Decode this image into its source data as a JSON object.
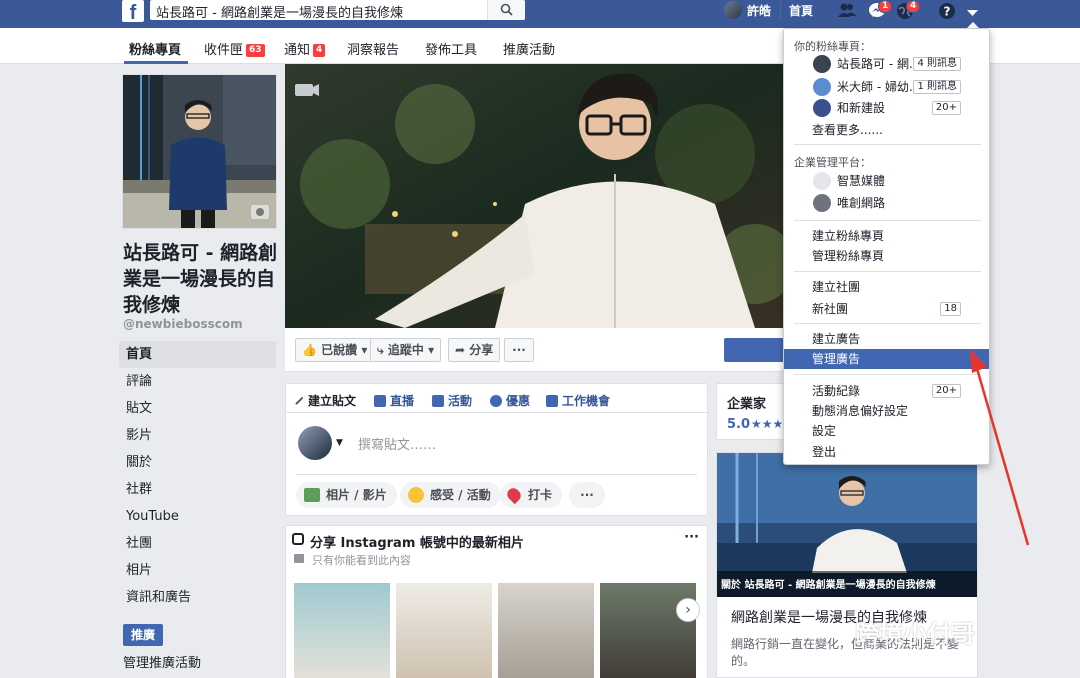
{
  "topbar": {
    "search_text": "站長路可 - 網路創業是一場漫長的自我修煉",
    "user_name": "許皓",
    "home_label": "首頁",
    "messages_count": "1",
    "notifications_count": "4"
  },
  "tabs": [
    {
      "label": "粉絲專頁",
      "badge": ""
    },
    {
      "label": "收件匣",
      "badge": "63"
    },
    {
      "label": "通知",
      "badge": "4"
    },
    {
      "label": "洞察報告",
      "badge": ""
    },
    {
      "label": "發佈工具",
      "badge": ""
    },
    {
      "label": "推廣活動",
      "badge": ""
    }
  ],
  "page": {
    "name": "站長路可 - 網路創業是一場漫長的自我修煉",
    "handle": "@newbiebosscom"
  },
  "left_nav": [
    "首頁",
    "評論",
    "貼文",
    "影片",
    "關於",
    "社群",
    "YouTube",
    "社團",
    "相片",
    "資訊和廣告"
  ],
  "promote_label": "推廣",
  "manage_promotions_label": "管理推廣活動",
  "actions": {
    "liked": "已說讚",
    "following": "追蹤中",
    "share": "分享",
    "more": "···"
  },
  "composer": {
    "tabs": [
      "建立貼文",
      "直播",
      "活動",
      "優惠",
      "工作機會"
    ],
    "placeholder": "撰寫貼文……",
    "pills": [
      "相片 / 影片",
      "感受 / 活動",
      "打卡"
    ],
    "more": "···"
  },
  "instagram": {
    "title": "分享 Instagram 帳號中的最新相片",
    "subtitle": "只有你能看到此內容",
    "more": "···"
  },
  "rating": {
    "category": "企業家",
    "score": "5.0",
    "stars": "★★★"
  },
  "about_card": {
    "caption": "關於 站長路可 - 網路創業是一場漫長的自我修煉",
    "title": "網路創業是一場漫長的自我修煉",
    "body": "網路行銷一直在變化，但商業的法則是不變的。"
  },
  "dropdown": {
    "pages_heading": "你的粉絲專頁：",
    "pages": [
      {
        "name": "站長路可 - 網...",
        "badge": "4 則訊息",
        "color": "#3a4350"
      },
      {
        "name": "米大師 - 婦幼...",
        "badge": "1 則訊息",
        "color": "#5b8bd1"
      },
      {
        "name": "和新建設",
        "badge": "20+",
        "color": "#3c4f8f"
      }
    ],
    "see_more": "查看更多......",
    "business_heading": "企業管理平台：",
    "businesses": [
      {
        "name": "智慧媒體",
        "color": "#e4e6eb"
      },
      {
        "name": "唯創網路",
        "color": "#6d7480"
      }
    ],
    "items_a": [
      "建立粉絲專頁",
      "管理粉絲專頁"
    ],
    "items_b": [
      {
        "label": "建立社團",
        "badge": ""
      },
      {
        "label": "新社團",
        "badge": "18"
      }
    ],
    "items_c": [
      "建立廣告",
      "管理廣告"
    ],
    "items_d": [
      {
        "label": "活動紀錄",
        "badge": "20+"
      },
      {
        "label": "動態消息偏好設定",
        "badge": ""
      },
      {
        "label": "設定",
        "badge": ""
      },
      {
        "label": "登出",
        "badge": ""
      }
    ]
  },
  "watermark": "跨境小付哥",
  "colors": {
    "brand": "#3b5998",
    "accent": "#4267b2",
    "badge": "#fa3e3e",
    "annotation": "#e8352c"
  }
}
